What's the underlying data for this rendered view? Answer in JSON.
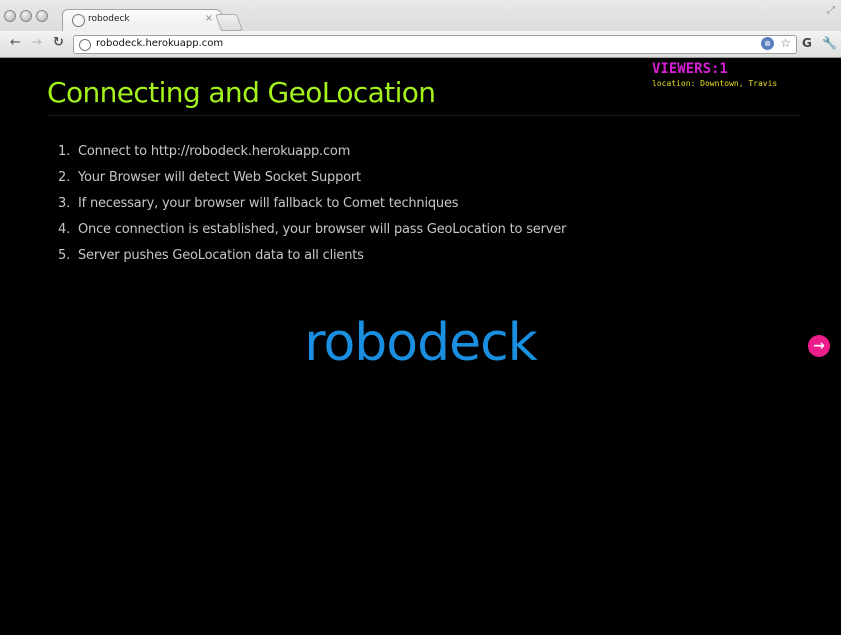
{
  "browser": {
    "tab_title": "robodeck",
    "tab_close": "×",
    "url": "robodeck.herokuapp.com",
    "icons": [
      "back-arrow-icon",
      "forward-arrow-icon",
      "reload-icon",
      "globe-icon",
      "extension-icon",
      "star-icon",
      "chrome-icon",
      "wrench-icon"
    ]
  },
  "slide": {
    "title": "Connecting and GeoLocation",
    "viewers": "VIEWERS:1",
    "location": "location: Downtown, Travis",
    "steps": [
      {
        "num": "1.",
        "text": "Connect to http://robodeck.herokuapp.com"
      },
      {
        "num": "2.",
        "text": "Your Browser will detect Web Socket Support"
      },
      {
        "num": "3.",
        "text": "If necessary, your browser will fallback to Comet techniques"
      },
      {
        "num": "4.",
        "text": "Once connection is established, your browser will pass GeoLocation to server"
      },
      {
        "num": "5.",
        "text": "Server pushes GeoLocation data to all clients"
      }
    ],
    "logo": "robodeck",
    "next_icon": "→"
  },
  "colors": {
    "title": "#a4f21c",
    "viewers": "#d61fd6",
    "location": "#e8e226",
    "logo": "#1a8fe0",
    "next_button": "#ee1d8c",
    "background": "#000000"
  }
}
